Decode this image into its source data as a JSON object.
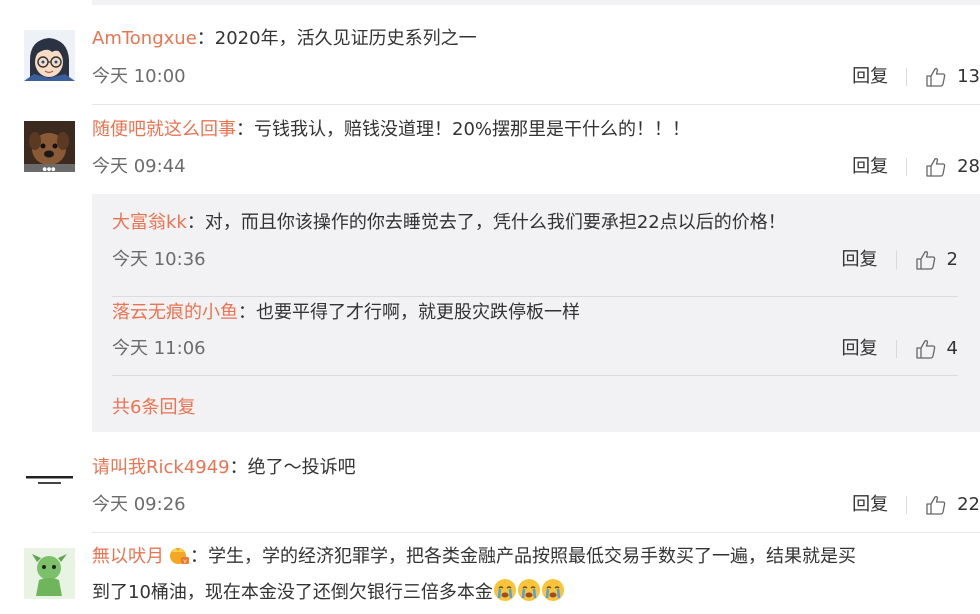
{
  "comments": [
    {
      "user": "AmTongxue",
      "text": "2020年，活久见证历史系列之一",
      "time": "今天 10:00",
      "reply_label": "回复",
      "likes": "13",
      "avatar": "anime-boy-glasses-avatar"
    },
    {
      "user": "随便吧就这么回事",
      "text": "亏钱我认，赔钱没道理！20%摆那里是干什么的！！！",
      "time": "今天 09:44",
      "reply_label": "回复",
      "likes": "28",
      "avatar": "dog-photo-avatar",
      "replies": [
        {
          "user": "大富翁kk",
          "text": "对，而且你该操作的你去睡觉去了，凭什么我们要承担22点以后的价格！",
          "time": "今天 10:36",
          "reply_label": "回复",
          "likes": "2"
        },
        {
          "user": "落云无痕的小鱼",
          "text": "也要平得了才行啊，就更股灾跌停板一样",
          "time": "今天 11:06",
          "reply_label": "回复",
          "likes": "4"
        }
      ],
      "more_replies": "共6条回复"
    },
    {
      "user": "请叫我Rick4949",
      "text": "绝了～投诉吧",
      "time": "今天 09:26",
      "reply_label": "回复",
      "likes": "22",
      "avatar": "text-image-avatar"
    },
    {
      "user": "無以吠月",
      "text_line1": "学生，学的经济犯罪学，把各类金融产品按照最低交易手数买了一遍，结果就是买",
      "text_line2": "到了10桶油，现在本金没了还倒欠银行三倍多本金",
      "avatar": "green-character-avatar",
      "emojis": [
        "crying-emoji",
        "crying-emoji",
        "crying-emoji"
      ],
      "badge": "vip-crown-badge"
    }
  ],
  "colors": {
    "username": "#eb7350",
    "text": "#333333",
    "time": "#6c6c6c",
    "reply_bg": "#f2f2f5"
  }
}
